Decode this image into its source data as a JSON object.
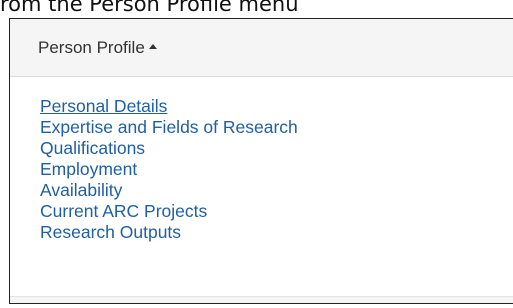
{
  "caption": "rom the Person Profile menu",
  "panel": {
    "title": "Person Profile",
    "title_icon": "caret-up-icon",
    "items": [
      {
        "label": "Personal Details",
        "active": true
      },
      {
        "label": "Expertise and Fields of Research"
      },
      {
        "label": "Qualifications"
      },
      {
        "label": "Employment"
      },
      {
        "label": "Availability"
      },
      {
        "label": "Current ARC Projects"
      },
      {
        "label": "Research Outputs"
      }
    ]
  },
  "colors": {
    "link": "#1f5fa6",
    "header_bg": "#f5f5f5",
    "title_text": "#333333"
  }
}
